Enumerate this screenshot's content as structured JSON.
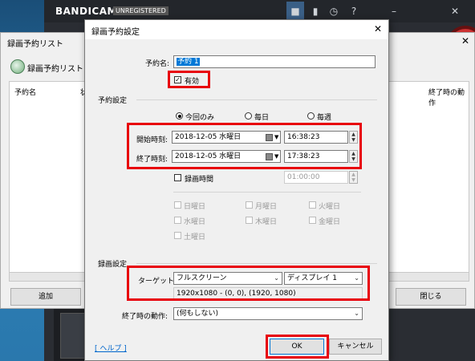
{
  "bandicam": {
    "logo": "BANDICAM",
    "unregistered": "UNREGISTERED",
    "icons": [
      "lock-icon",
      "folder-icon",
      "clock-icon",
      "help-icon",
      "minimize-icon",
      "close-icon"
    ]
  },
  "list_window": {
    "title": "録画予約リスト",
    "header_label": "録画予約リストを",
    "columns": [
      "予約名",
      "状",
      "終了時の動作"
    ],
    "add_button": "追加",
    "close_button": "閉じる"
  },
  "dialog": {
    "title": "録画予約設定",
    "name_label": "予約名:",
    "name_value": "予約 1",
    "enabled_label": "有効",
    "enabled_checked": true,
    "schedule_group": "予約設定",
    "repeat_options": [
      "今回のみ",
      "毎日",
      "毎週"
    ],
    "repeat_selected": 0,
    "start_label": "開始時刻:",
    "start_date": "2018-12-05 水曜日",
    "start_time": "16:38:23",
    "end_label": "終了時刻:",
    "end_date": "2018-12-05 水曜日",
    "end_time": "17:38:23",
    "duration_label": "録画時間",
    "duration_value": "01:00:00",
    "weekdays": [
      "日曜日",
      "月曜日",
      "火曜日",
      "水曜日",
      "木曜日",
      "金曜日",
      "土曜日"
    ],
    "recording_group": "録画設定",
    "target_label": "ターゲット:",
    "target_mode": "フルスクリーン",
    "target_display": "ディスプレイ 1",
    "target_info": "1920x1080 - (0, 0), (1920, 1080)",
    "end_action_label": "終了時の動作:",
    "end_action_value": "(何もしない)",
    "help_link": "[ ヘルプ ]",
    "ok_button": "OK",
    "cancel_button": "キャンセル"
  },
  "colors": {
    "highlight_red": "#e8000b",
    "selection_blue": "#0078d7",
    "bandicam_dark": "#2a2d33"
  }
}
